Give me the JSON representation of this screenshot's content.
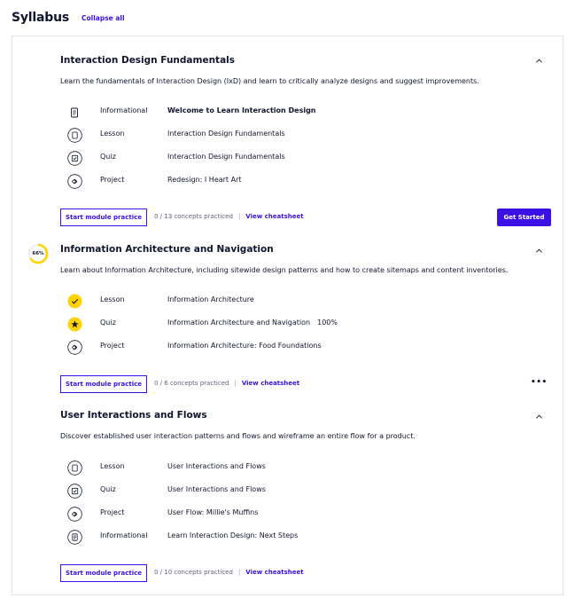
{
  "header": {
    "title": "Syllabus",
    "collapse_label": "Collapse all"
  },
  "modules": [
    {
      "title": "Interaction Design Fundamentals",
      "description": "Learn the fundamentals of Interaction Design (IxD) and learn to critically analyze designs and suggest improvements.",
      "items": [
        {
          "type": "Informational",
          "name": "Welcome to Learn Interaction Design",
          "icon": "document-icon"
        },
        {
          "type": "Lesson",
          "name": "Interaction Design Fundamentals",
          "icon": "lesson-icon"
        },
        {
          "type": "Quiz",
          "name": "Interaction Design Fundamentals",
          "icon": "quiz-icon"
        },
        {
          "type": "Project",
          "name": "Redesign: I Heart Art",
          "icon": "project-icon"
        }
      ],
      "practice_label": "Start module practice",
      "concepts": "0 / 13 concepts practiced",
      "separator": "|",
      "cheatsheet_label": "View cheatsheet",
      "cta_label": "Get Started"
    },
    {
      "title": "Information Architecture and Navigation",
      "progress_label": "66%",
      "progress_value": 0.66,
      "description": "Learn about Information Architecture, including sitewide design patterns and how to create sitemaps and content inventories.",
      "items": [
        {
          "type": "Lesson",
          "name": "Information Architecture",
          "icon": "check-icon"
        },
        {
          "type": "Quiz",
          "name": "Information Architecture and Navigation",
          "score": "100%",
          "icon": "star-icon"
        },
        {
          "type": "Project",
          "name": "Information Architecture: Food Foundations",
          "icon": "project-icon"
        }
      ],
      "practice_label": "Start module practice",
      "concepts": "0 / 6 concepts practiced",
      "separator": "|",
      "cheatsheet_label": "View cheatsheet",
      "more_label": "•••"
    },
    {
      "title": "User Interactions and Flows",
      "description": "Discover established user interaction patterns and flows and wireframe an entire flow for a product.",
      "items": [
        {
          "type": "Lesson",
          "name": "User Interactions and Flows",
          "icon": "lesson-icon"
        },
        {
          "type": "Quiz",
          "name": "User Interactions and Flows",
          "icon": "quiz-icon"
        },
        {
          "type": "Project",
          "name": "User Flow: Millie's Muffins",
          "icon": "project-icon"
        },
        {
          "type": "Informational",
          "name": "Learn Interaction Design: Next Steps",
          "icon": "document-icon"
        }
      ],
      "practice_label": "Start module practice",
      "concepts": "0 / 10 concepts practiced",
      "separator": "|",
      "cheatsheet_label": "View cheatsheet"
    }
  ],
  "colors": {
    "accent": "#3a10e5",
    "yellow": "#ffd300",
    "text": "#10162f"
  }
}
